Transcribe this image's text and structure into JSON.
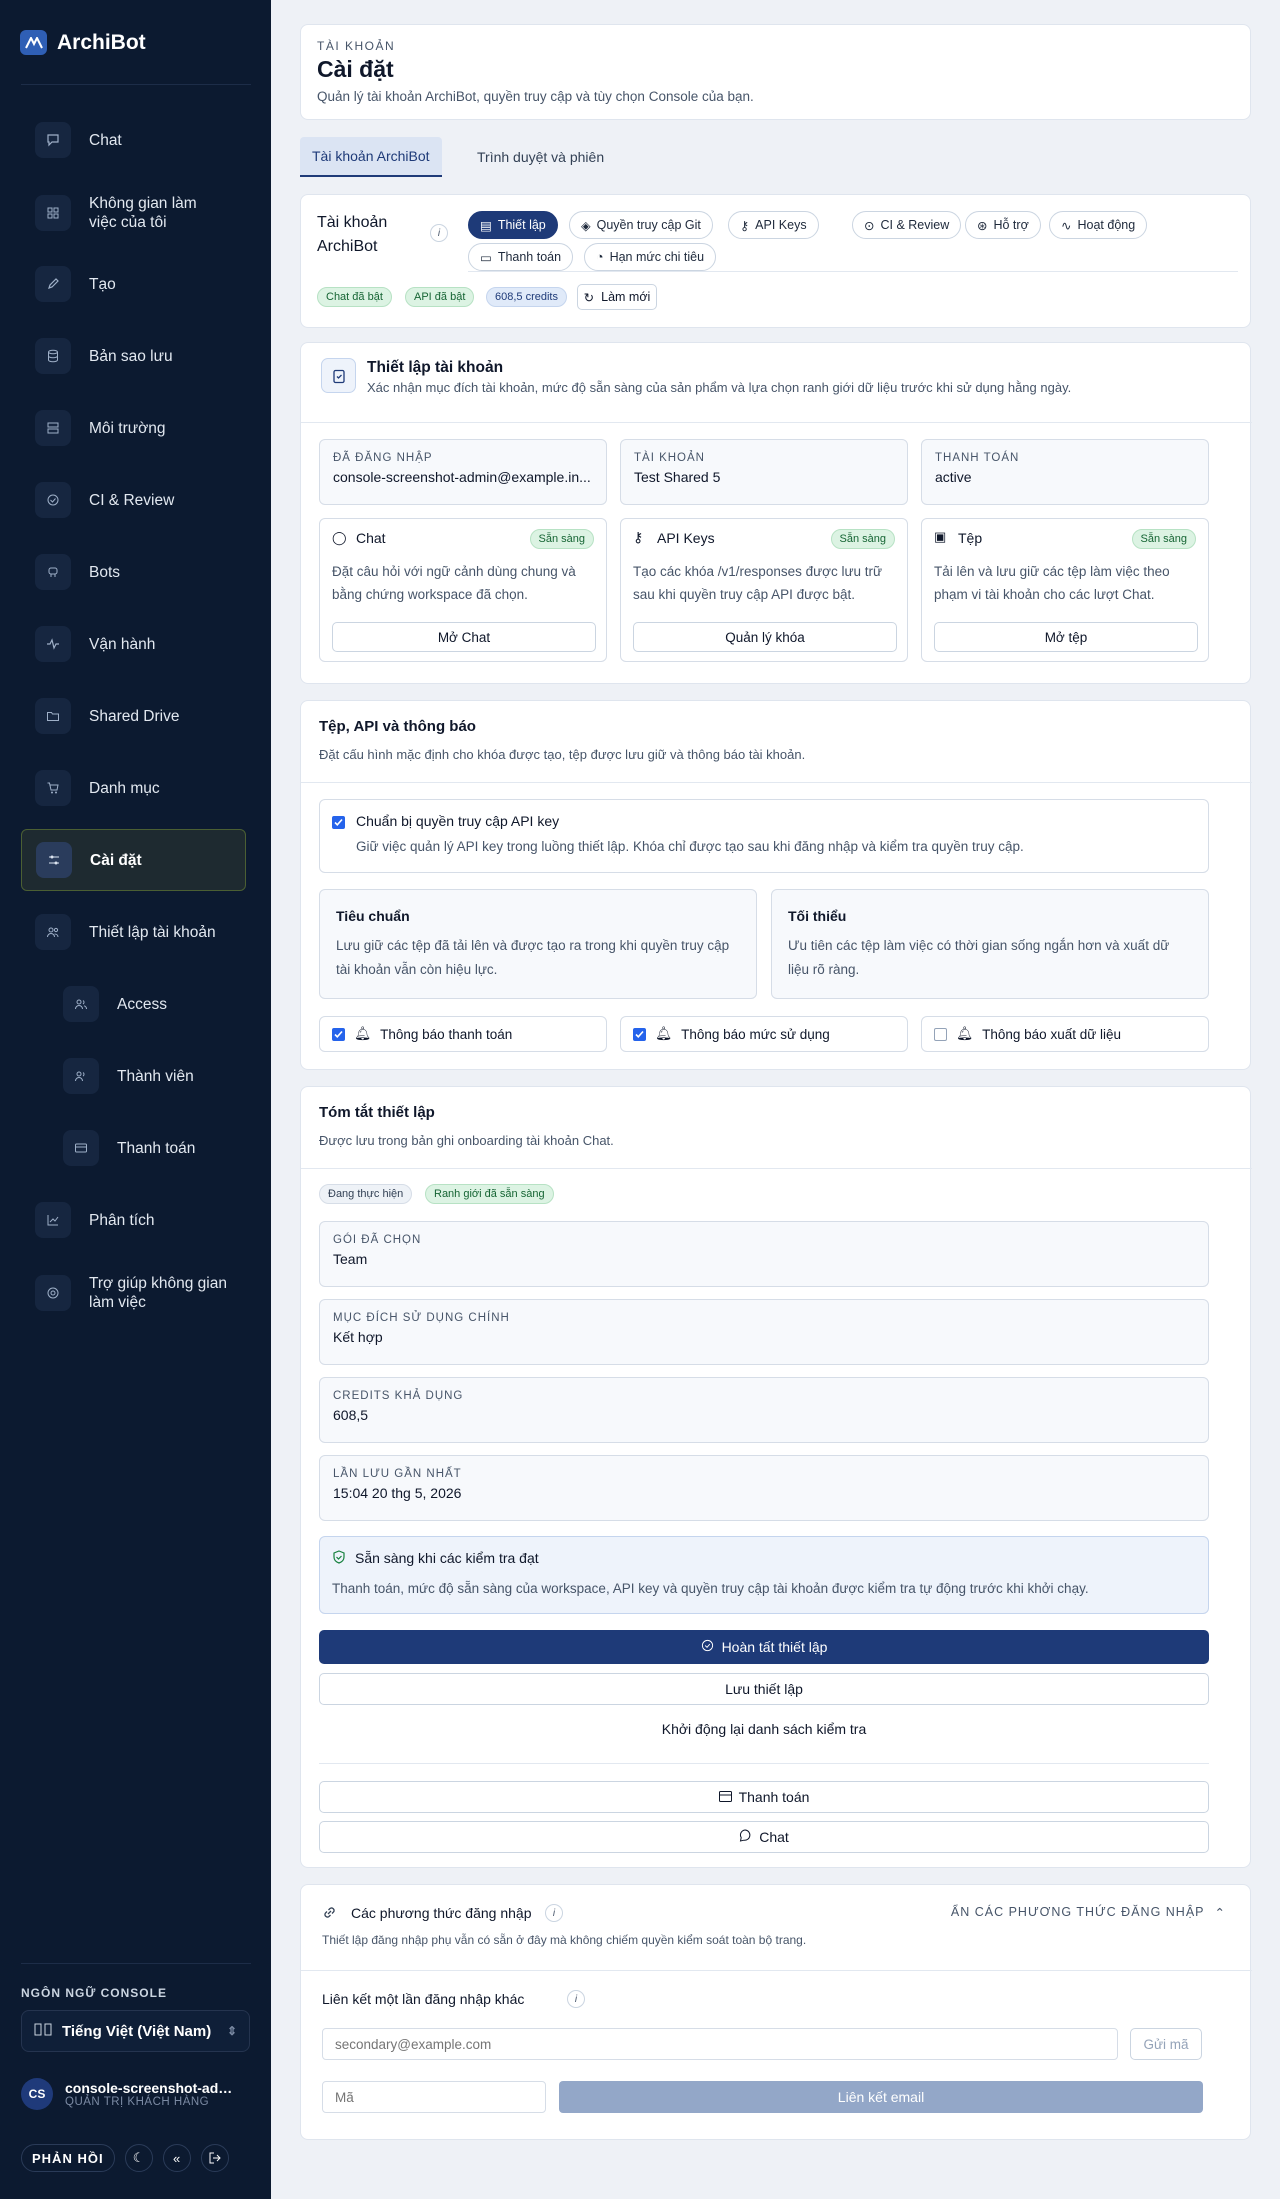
{
  "brand": {
    "name": "ArchiBot"
  },
  "nav": [
    {
      "label": "Chat",
      "icon": "chat-icon"
    },
    {
      "label": "Không gian làm việc của tôi",
      "icon": "grid-icon"
    },
    {
      "label": "Tạo",
      "icon": "pencil-icon"
    },
    {
      "label": "Bản sao lưu",
      "icon": "database-icon"
    },
    {
      "label": "Môi trường",
      "icon": "server-icon"
    },
    {
      "label": "CI & Review",
      "icon": "check-circle-icon"
    },
    {
      "label": "Bots",
      "icon": "bot-icon"
    },
    {
      "label": "Vận hành",
      "icon": "activity-icon"
    },
    {
      "label": "Shared Drive",
      "icon": "folder-icon"
    },
    {
      "label": "Danh mục",
      "icon": "cart-icon"
    },
    {
      "label": "Cài đặt",
      "icon": "sliders-icon"
    },
    {
      "label": "Thiết lập tài khoản",
      "icon": "users-setup-icon"
    },
    {
      "label": "Access",
      "icon": "users-icon"
    },
    {
      "label": "Thành viên",
      "icon": "user-icon"
    },
    {
      "label": "Thanh toán",
      "icon": "card-icon"
    },
    {
      "label": "Phân tích",
      "icon": "chart-icon"
    },
    {
      "label": "Trợ giúp không gian làm việc",
      "icon": "help-icon"
    }
  ],
  "sidebar_footer": {
    "lang_label": "NGÔN NGỮ CONSOLE",
    "lang_value": "Tiếng Việt (Việt Nam)",
    "user_initials": "CS",
    "user_name": "console-screenshot-admin",
    "user_role": "QUẢN TRỊ KHÁCH HÀNG",
    "feedback": "PHẢN HỒI"
  },
  "header": {
    "kicker": "TÀI KHOẢN",
    "title": "Cài đặt",
    "subtitle": "Quản lý tài khoản ArchiBot, quyền truy cập và tùy chọn Console của bạn."
  },
  "tabs": [
    "Tài khoản ArchiBot",
    "Trình duyệt và phiên"
  ],
  "account": {
    "title": "Tài khoản ArchiBot",
    "pills": [
      "Thiết lập",
      "Quyền truy cập Git",
      "API Keys",
      "CI & Review",
      "Hỗ trợ",
      "Hoạt động",
      "Thanh toán",
      "Hạn mức chi tiêu"
    ],
    "badges": [
      "Chat đã bật",
      "API đã bật",
      "608,5 credits"
    ],
    "refresh": "Làm mới"
  },
  "setup": {
    "title": "Thiết lập tài khoản",
    "subtitle": "Xác nhận mục đích tài khoản, mức độ sẵn sàng của sản phẩm và lựa chọn ranh giới dữ liệu trước khi sử dụng hằng ngày.",
    "fields": [
      {
        "k": "ĐÃ ĐĂNG NHẬP",
        "v": "console-screenshot-admin@example.in..."
      },
      {
        "k": "TÀI KHOẢN",
        "v": "Test Shared 5"
      },
      {
        "k": "THANH TOÁN",
        "v": "active"
      }
    ],
    "products": [
      {
        "name": "Chat",
        "status": "Sẵn sàng",
        "desc": "Đặt câu hỏi với ngữ cảnh dùng chung và bằng chứng workspace đã chọn.",
        "action": "Mở Chat"
      },
      {
        "name": "API Keys",
        "status": "Sẵn sàng",
        "desc": "Tạo các khóa /v1/responses được lưu trữ sau khi quyền truy cập API được bật.",
        "action": "Quản lý khóa"
      },
      {
        "name": "Tệp",
        "status": "Sẵn sàng",
        "desc": "Tải lên và lưu giữ các tệp làm việc theo phạm vi tài khoản cho các lượt Chat.",
        "action": "Mở tệp"
      }
    ]
  },
  "files": {
    "title": "Tệp, API và thông báo",
    "subtitle": "Đặt cấu hình mặc định cho khóa được tạo, tệp được lưu giữ và thông báo tài khoản.",
    "apikey_title": "Chuẩn bị quyền truy cập API key",
    "apikey_desc": "Giữ việc quản lý API key trong luồng thiết lập. Khóa chỉ được tạo sau khi đăng nhập và kiểm tra quyền truy cập.",
    "options": [
      {
        "title": "Tiêu chuẩn",
        "desc": "Lưu giữ các tệp đã tải lên và được tạo ra trong khi quyền truy cập tài khoản vẫn còn hiệu lực."
      },
      {
        "title": "Tối thiểu",
        "desc": "Ưu tiên các tệp làm việc có thời gian sống ngắn hơn và xuất dữ liệu rõ ràng."
      }
    ],
    "notifications": [
      {
        "label": "Thông báo thanh toán",
        "checked": true
      },
      {
        "label": "Thông báo mức sử dụng",
        "checked": true
      },
      {
        "label": "Thông báo xuất dữ liệu",
        "checked": false
      }
    ]
  },
  "summary": {
    "title": "Tóm tắt thiết lập",
    "subtitle": "Được lưu trong bản ghi onboarding tài khoản Chat.",
    "badges": [
      "Đang thực hiện",
      "Ranh giới đã sẵn sàng"
    ],
    "fields": [
      {
        "k": "GÓI ĐÃ CHỌN",
        "v": "Team"
      },
      {
        "k": "MỤC ĐÍCH SỬ DỤNG CHÍNH",
        "v": "Kết hợp"
      },
      {
        "k": "CREDITS KHẢ DỤNG",
        "v": "608,5"
      },
      {
        "k": "LẦN LƯU GẦN NHẤT",
        "v": "15:04 20 thg 5, 2026"
      }
    ],
    "ready_title": "Sẵn sàng khi các kiểm tra đạt",
    "ready_desc": "Thanh toán, mức độ sẵn sàng của workspace, API key và quyền truy cập tài khoản được kiểm tra tự động trước khi khởi chạy.",
    "complete": "Hoàn tất thiết lập",
    "save": "Lưu thiết lập",
    "restart": "Khởi động lại danh sách kiểm tra",
    "billing": "Thanh toán",
    "chat": "Chat"
  },
  "signin": {
    "title": "Các phương thức đăng nhập",
    "toggle": "ẨN CÁC PHƯƠNG THỨC ĐĂNG NHẬP",
    "desc": "Thiết lập đăng nhập phụ vẫn có sẵn ở đây mà không chiếm quyền kiểm soát toàn bộ trang.",
    "link_title": "Liên kết một lần đăng nhập khác",
    "email_placeholder": "secondary@example.com",
    "send": "Gửi mã",
    "code_placeholder": "Mã",
    "link_email": "Liên kết email"
  }
}
